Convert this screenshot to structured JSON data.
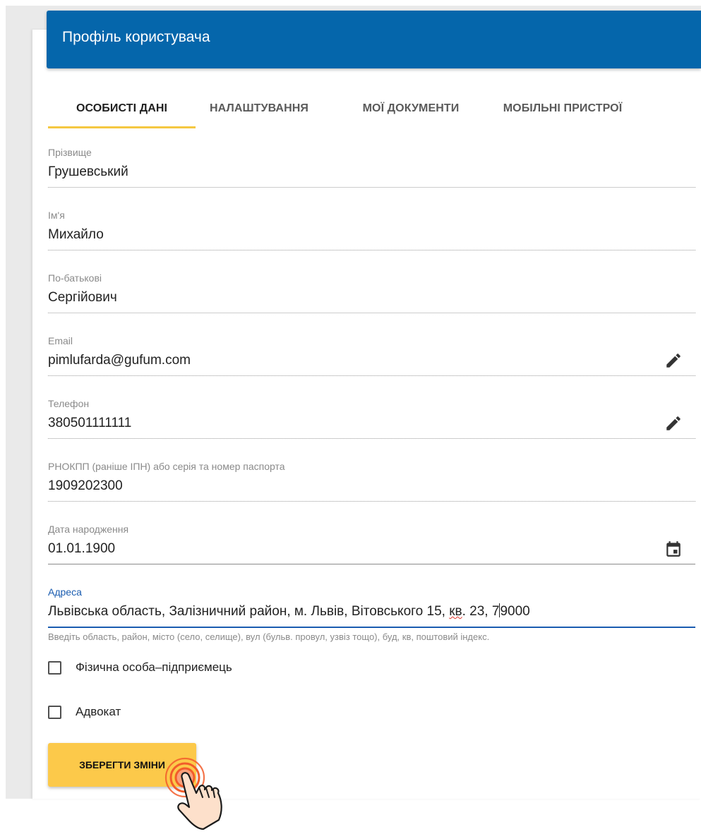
{
  "header": {
    "title": "Профіль користувача"
  },
  "tabs": [
    {
      "label": "ОСОБИСТІ ДАНІ",
      "active": true
    },
    {
      "label": "НАЛАШТУВАННЯ",
      "active": false
    },
    {
      "label": "МОЇ ДОКУМЕНТИ",
      "active": false
    },
    {
      "label": "МОБІЛЬНІ ПРИСТРОЇ",
      "active": false
    }
  ],
  "fields": {
    "surname": {
      "label": "Прізвище",
      "value": "Грушевський"
    },
    "name": {
      "label": "Ім'я",
      "value": "Михайло"
    },
    "patronymic": {
      "label": "По-батькові",
      "value": "Сергійович"
    },
    "email": {
      "label": "Email",
      "value": "pimlufarda@gufum.com",
      "icon": "edit-pencil-icon"
    },
    "phone": {
      "label": "Телефон",
      "value": "380501111111",
      "icon": "edit-pencil-icon"
    },
    "tax_id": {
      "label": "РНОКПП (раніше ІПН) або серія та номер паспорта",
      "value": "1909202300"
    },
    "birth_date": {
      "label": "Дата народження",
      "value": "01.01.1900",
      "icon": "calendar-icon"
    },
    "address": {
      "label": "Адреса",
      "value_before_squiggle": "Львівська область, Залізничний район, м. Львів, Вітовського 15, ",
      "value_squiggle": "кв",
      "value_after_squiggle_before_caret": ". 23, 7",
      "value_after_caret": "9000",
      "helper": "Введіть область, район, місто (село, селище), вул (бульв. провул, узвіз тощо), буд, кв, поштовий індекс."
    }
  },
  "checkboxes": [
    {
      "label": "Фізична особа–підприємець",
      "checked": false
    },
    {
      "label": "Адвокат",
      "checked": false
    }
  ],
  "actions": {
    "save_label": "ЗБЕРЕГТИ ЗМІНИ"
  },
  "colors": {
    "header_bg": "#0566ab",
    "tab_indicator": "#f5c842",
    "focus_blue": "#1a5cb0",
    "save_button": "#fcc94a",
    "tap_ring": "#f25c2a"
  }
}
